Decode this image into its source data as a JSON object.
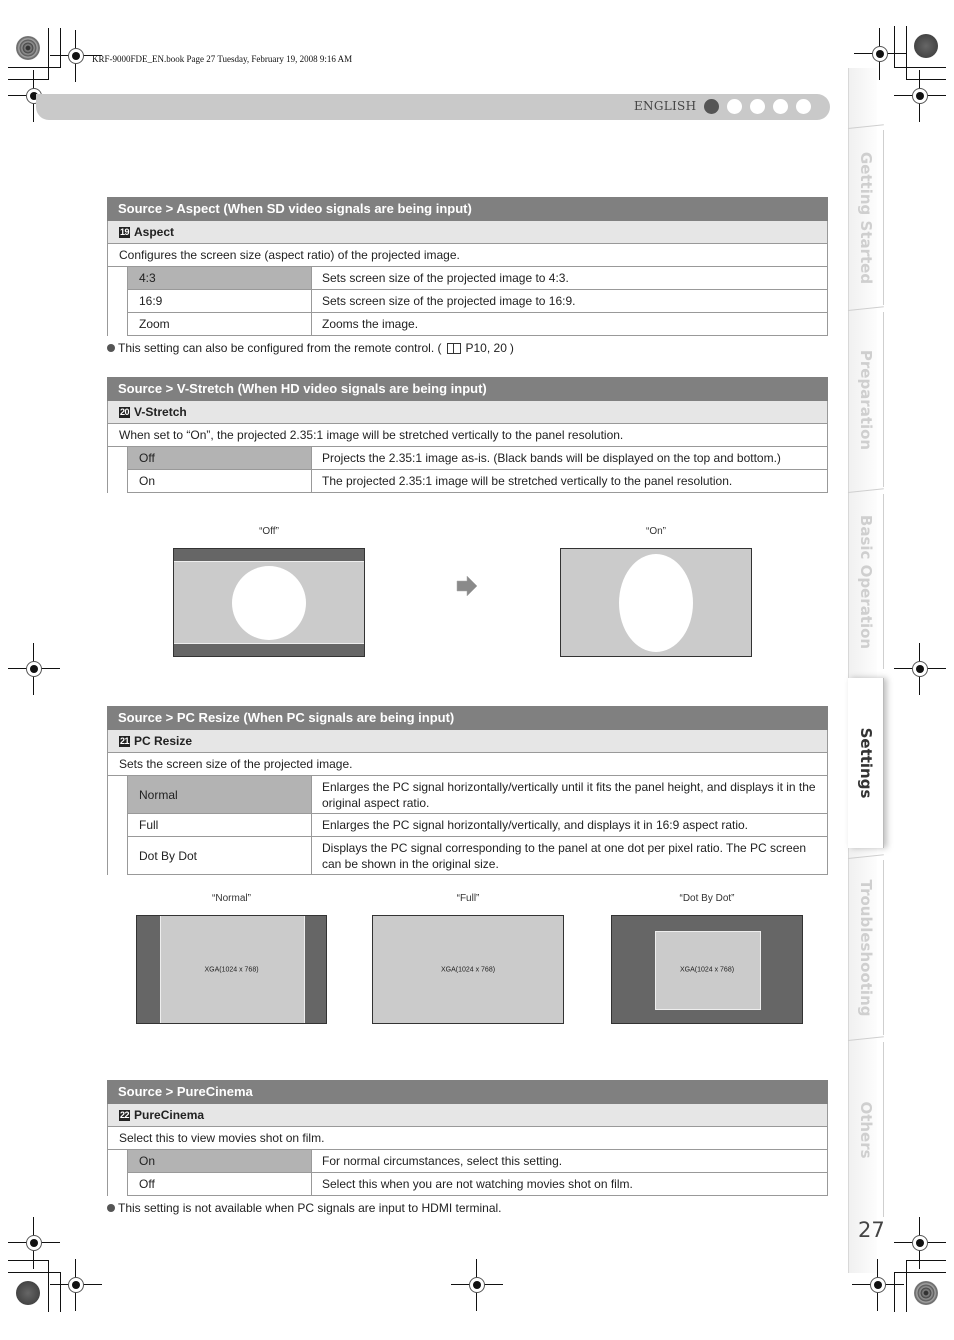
{
  "book_meta": "KRF-9000FDE_EN.book  Page 27  Tuesday, February 19, 2008  9:16 AM",
  "header": {
    "language": "ENGLISH",
    "pager_dots": 5,
    "active_dot": 1
  },
  "side_tabs": [
    {
      "label": "Getting Started",
      "active": false
    },
    {
      "label": "Preparation",
      "active": false
    },
    {
      "label": "Basic Operation",
      "active": false
    },
    {
      "label": "Settings",
      "active": true
    },
    {
      "label": "Troubleshooting",
      "active": false
    },
    {
      "label": "Others",
      "active": false
    }
  ],
  "page_number": "27",
  "sections": [
    {
      "title": "Source > Aspect (When SD video signals are being input)",
      "number": "19",
      "name": "Aspect",
      "description": "Configures the screen size (aspect ratio) of the projected image.",
      "options": [
        {
          "key": "4:3",
          "value": "Sets screen size of the projected image to 4:3.",
          "default": true
        },
        {
          "key": "16:9",
          "value": "Sets screen size of the projected image to 16:9.",
          "default": false
        },
        {
          "key": "Zoom",
          "value": "Zooms the image.",
          "default": false
        }
      ],
      "note": "This setting can also be configured from the remote control. (",
      "note_ref": "P10, 20",
      "note_end": ")"
    },
    {
      "title": "Source > V-Stretch (When HD video signals are being input)",
      "number": "20",
      "name": "V-Stretch",
      "description": "When set to “On”, the projected 2.35:1 image will be stretched vertically to the panel resolution.",
      "options": [
        {
          "key": "Off",
          "value": "Projects the 2.35:1 image as-is. (Black bands will be displayed on the top and bottom.)",
          "default": true
        },
        {
          "key": "On",
          "value": "The projected 2.35:1 image will be stretched vertically to the panel resolution.",
          "default": false
        }
      ],
      "illustrations": {
        "off_caption": "“Off”",
        "on_caption": "“On”"
      }
    },
    {
      "title": "Source > PC Resize (When PC signals are being input)",
      "number": "21",
      "name": "PC Resize",
      "description": "Sets the screen size of the projected image.",
      "options": [
        {
          "key": "Normal",
          "value": "Enlarges the PC signal horizontally/vertically until it fits the panel height, and displays it in the original aspect ratio.",
          "default": true
        },
        {
          "key": "Full",
          "value": "Enlarges the PC signal horizontally/vertically, and displays it in 16:9 aspect ratio.",
          "default": false
        },
        {
          "key": "Dot By Dot",
          "value": "Displays the PC signal corresponding to the panel at one dot per pixel ratio. The PC screen can be shown in the original size.",
          "default": false
        }
      ],
      "illustrations": {
        "normal_caption": "“Normal”",
        "full_caption": "“Full”",
        "dotbydot_caption": "“Dot By Dot”",
        "signal_label": "XGA(1024 x 768)"
      }
    },
    {
      "title": "Source > PureCinema",
      "number": "22",
      "name": "PureCinema",
      "description": "Select this to view movies shot on film.",
      "options": [
        {
          "key": "On",
          "value": "For normal circumstances, select this setting.",
          "default": true
        },
        {
          "key": "Off",
          "value": "Select this when you are not watching movies shot on film.",
          "default": false
        }
      ],
      "note": "This setting is not available when PC signals are input to HDMI terminal."
    }
  ]
}
